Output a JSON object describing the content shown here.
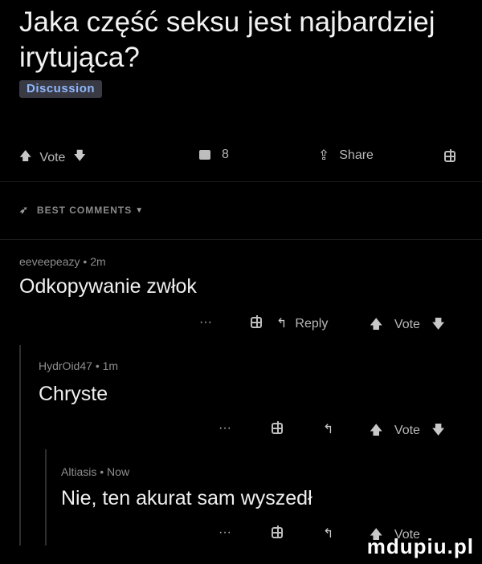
{
  "post": {
    "title": "Jaka część seksu jest najbardziej irytująca?",
    "flair": "Discussion"
  },
  "post_actions": {
    "vote_label": "Vote",
    "comments_count": "8",
    "share_label": "Share"
  },
  "comments_header": {
    "label": "BEST COMMENTS"
  },
  "comments": [
    {
      "author": "eeveepeazy",
      "time": "2m",
      "text": "Odkopywanie zwłok",
      "more": "···",
      "reply_label": "Reply",
      "vote_label": "Vote"
    },
    {
      "author": "HydrOid47",
      "time": "1m",
      "text": "Chryste",
      "more": "···",
      "vote_label": "Vote"
    },
    {
      "author": "Altiasis",
      "time": "Now",
      "text": "Nie, ten akurat sam wyszedł",
      "more": "···",
      "vote_label": "Vote"
    }
  ],
  "watermark": "mdupiu.pl"
}
